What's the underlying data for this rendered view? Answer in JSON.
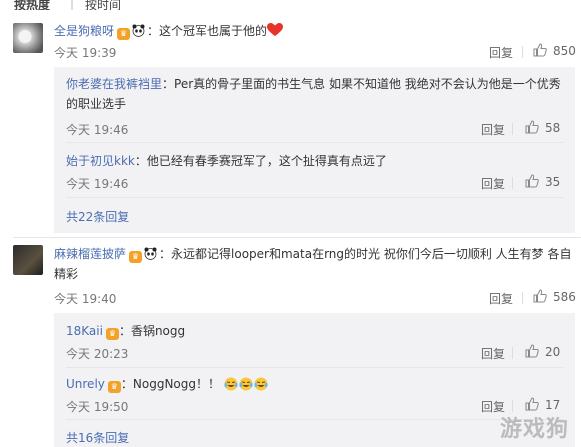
{
  "sort_tabs": {
    "hot": "按热度",
    "time": "按时间"
  },
  "comments": [
    {
      "user": "全是狗粮呀",
      "text": "：这个冠军也属于他的",
      "time": "今天 19:39",
      "reply_label": "回复",
      "likes": "850",
      "replies": [
        {
          "user": "你老婆在我裤裆里",
          "text": "：Per真的骨子里面的书生气息 如果不知道他 我绝对不会认为他是一个优秀",
          "text2": "的职业选手",
          "time": "今天 19:46",
          "reply_label": "回复",
          "likes": "58"
        },
        {
          "user": "始于初见kkk",
          "text": "：他已经有春季赛冠军了，这个扯得真有点远了",
          "time": "今天 19:46",
          "reply_label": "回复",
          "likes": "35"
        }
      ],
      "more_replies": "共22条回复"
    },
    {
      "user": "麻辣榴莲披萨",
      "text": "：永远都记得looper和mata在rng的时光 祝你们今后一切顺利 人生有梦 各自",
      "text2": "精彩",
      "time": "今天 19:40",
      "reply_label": "回复",
      "likes": "586",
      "replies": [
        {
          "user": "18Kaii",
          "text": "：香锅nogg",
          "time": "今天 20:23",
          "reply_label": "回复",
          "likes": "20"
        },
        {
          "user": "Unrely",
          "text": "：NoggNogg！！",
          "time": "今天 19:50",
          "reply_label": "回复",
          "likes": "17"
        }
      ],
      "more_replies": "共16条回复"
    }
  ],
  "watermark": "游戏狗",
  "colors": {
    "link": "#4b6db1",
    "reply_bg": "#f2f2f5",
    "badge": "#f4a12a",
    "heart": "#e8332a"
  }
}
